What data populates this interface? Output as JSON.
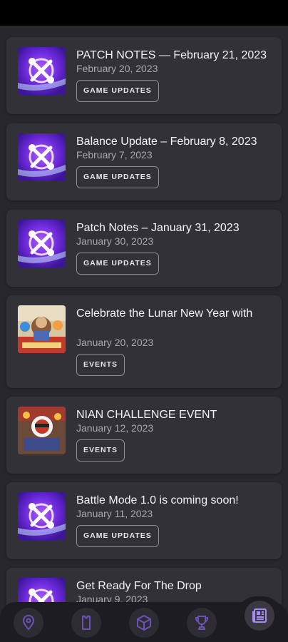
{
  "feed": {
    "items": [
      {
        "title": "PATCH NOTES — February 21, 2023",
        "date": "February 20, 2023",
        "tag": "GAME UPDATES",
        "thumbnail": "game-updates-wrench-icon"
      },
      {
        "title": "Balance Update – February 8, 2023",
        "date": "February 7, 2023",
        "tag": "GAME UPDATES",
        "thumbnail": "game-updates-wrench-icon"
      },
      {
        "title": "Patch Notes – January 31, 2023",
        "date": "January 30, 2023",
        "tag": "GAME UPDATES",
        "thumbnail": "game-updates-wrench-icon"
      },
      {
        "title": "Celebrate the Lunar New Year with",
        "date": "January 20, 2023",
        "tag": "EVENTS",
        "thumbnail": "lunar-new-year-event-image"
      },
      {
        "title": "NIAN CHALLENGE EVENT",
        "date": "January 12, 2023",
        "tag": "EVENTS",
        "thumbnail": "nian-challenge-event-image"
      },
      {
        "title": "Battle Mode 1.0 is coming soon!",
        "date": "January 11, 2023",
        "tag": "GAME UPDATES",
        "thumbnail": "game-updates-wrench-icon"
      },
      {
        "title": "Get Ready For The Drop",
        "date": "January 9, 2023",
        "tag": "",
        "thumbnail": "game-updates-wrench-icon"
      }
    ]
  },
  "bottom_nav": {
    "items": [
      {
        "icon": "map-pin-icon"
      },
      {
        "icon": "inventory-icon"
      },
      {
        "icon": "cube-icon"
      },
      {
        "icon": "trophy-icon"
      },
      {
        "icon": "news-icon",
        "active": true
      }
    ]
  },
  "colors": {
    "background": "#28272c",
    "card": "#323137",
    "nav": "#1d1c21",
    "accent_purple": "#7b3fe0"
  }
}
